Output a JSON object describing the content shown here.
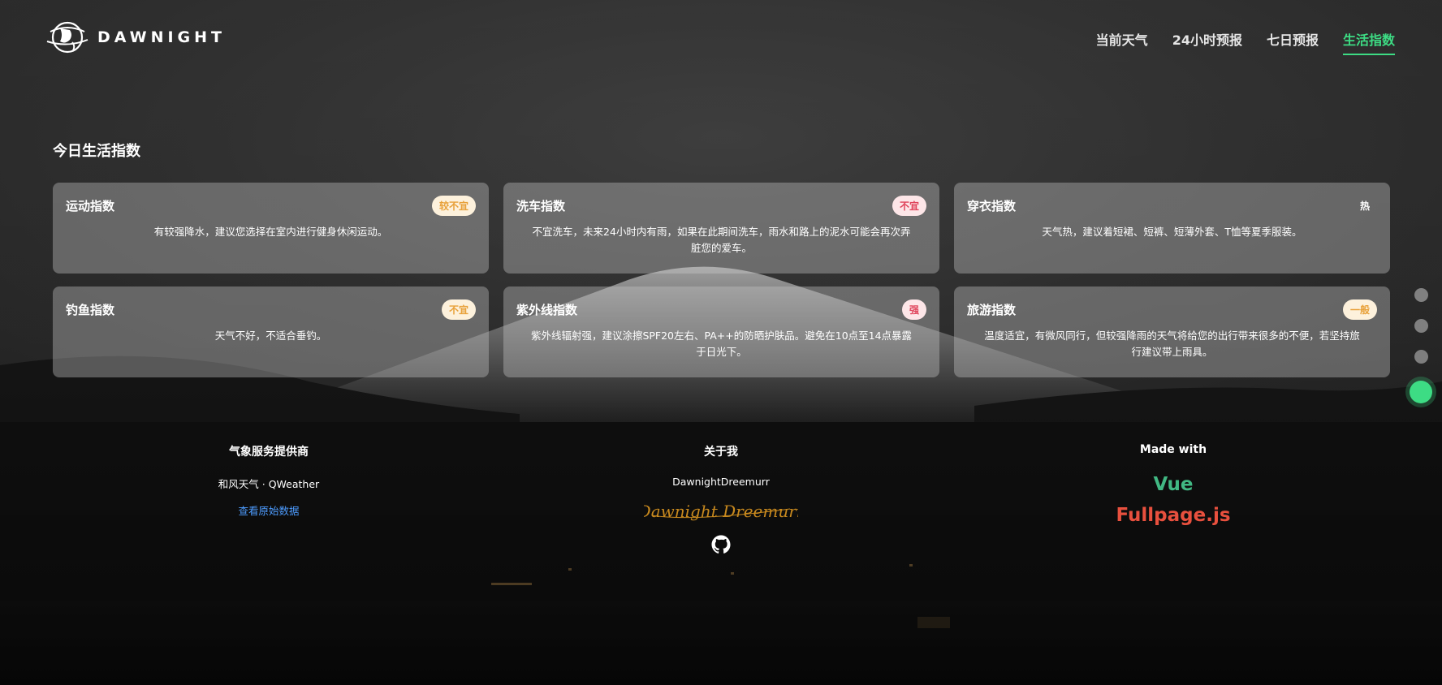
{
  "header": {
    "logo_text": "DAWNIGHT",
    "nav": [
      {
        "label": "当前天气"
      },
      {
        "label": "24小时预报"
      },
      {
        "label": "七日预报"
      },
      {
        "label": "生活指数",
        "active": true
      }
    ]
  },
  "section": {
    "title": "今日生活指数"
  },
  "cards": [
    {
      "title": "运动指数",
      "level": "较不宜",
      "level_color": "orange",
      "desc": "有较强降水，建议您选择在室内进行健身休闲运动。"
    },
    {
      "title": "洗车指数",
      "level": "不宜",
      "level_color": "red",
      "desc": "不宜洗车，未来24小时内有雨，如果在此期间洗车，雨水和路上的泥水可能会再次弄脏您的爱车。"
    },
    {
      "title": "穿衣指数",
      "level": "热",
      "level_color": "plain",
      "desc": "天气热，建议着短裙、短裤、短薄外套、T恤等夏季服装。"
    },
    {
      "title": "钓鱼指数",
      "level": "不宜",
      "level_color": "orange",
      "desc": "天气不好，不适合垂钓。"
    },
    {
      "title": "紫外线指数",
      "level": "强",
      "level_color": "red",
      "desc": "紫外线辐射强，建议涂擦SPF20左右、PA++的防晒护肤品。避免在10点至14点暴露于日光下。"
    },
    {
      "title": "旅游指数",
      "level": "一般",
      "level_color": "orange",
      "desc": "温度适宜，有微风同行，但较强降雨的天气将给您的出行带来很多的不便，若坚持旅行建议带上雨具。"
    }
  ],
  "page_dots": {
    "count": 4,
    "active_index": 3
  },
  "footer": {
    "provider": {
      "heading": "气象服务提供商",
      "name": "和风天气 · QWeather",
      "link": "查看原始数据"
    },
    "about": {
      "heading": "关于我",
      "name": "DawnightDreemurr",
      "signature": "Dawnight Dreemurr"
    },
    "made_with": {
      "heading": "Made with",
      "items": [
        "Vue",
        "Fullpage.js"
      ]
    }
  },
  "colors": {
    "accent": "#3ddc84",
    "link": "#4d9cff",
    "vue": "#41b883",
    "fullpage": "#e8503e"
  }
}
